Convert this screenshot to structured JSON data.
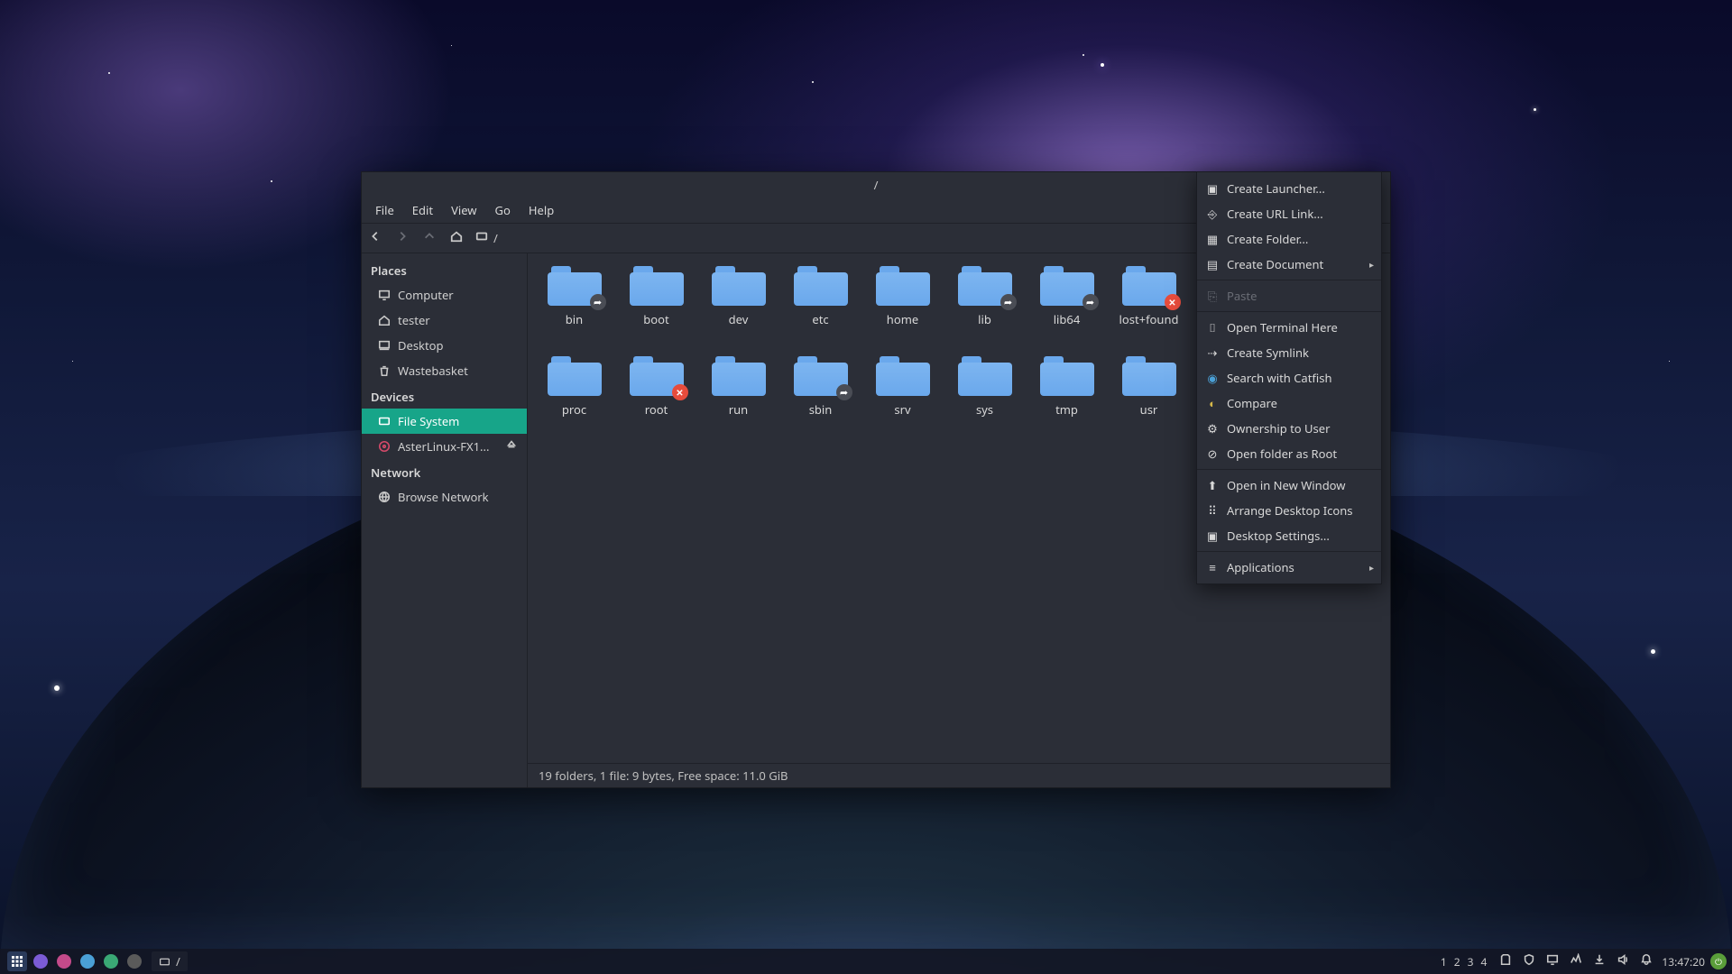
{
  "window": {
    "title": "/",
    "menu": {
      "file": "File",
      "edit": "Edit",
      "view": "View",
      "go": "Go",
      "help": "Help"
    },
    "path": "/"
  },
  "sidebar": {
    "places_hdr": "Places",
    "devices_hdr": "Devices",
    "network_hdr": "Network",
    "places": [
      {
        "label": "Computer",
        "icon": "monitor"
      },
      {
        "label": "tester",
        "icon": "home"
      },
      {
        "label": "Desktop",
        "icon": "desktop"
      },
      {
        "label": "Wastebasket",
        "icon": "trash"
      }
    ],
    "devices": [
      {
        "label": "File System",
        "icon": "disk",
        "selected": true
      },
      {
        "label": "AsterLinux-FX1...",
        "icon": "disc",
        "eject": true
      }
    ],
    "network": [
      {
        "label": "Browse Network",
        "icon": "globe"
      }
    ]
  },
  "folders": [
    {
      "name": "bin",
      "badge": "link"
    },
    {
      "name": "boot"
    },
    {
      "name": "dev"
    },
    {
      "name": "etc"
    },
    {
      "name": "home"
    },
    {
      "name": "lib",
      "badge": "link"
    },
    {
      "name": "lib64",
      "badge": "link"
    },
    {
      "name": "lost+found",
      "badge": "err"
    },
    {
      "name": "proc"
    },
    {
      "name": "root",
      "badge": "err"
    },
    {
      "name": "run"
    },
    {
      "name": "sbin",
      "badge": "link"
    },
    {
      "name": "srv"
    },
    {
      "name": "sys"
    },
    {
      "name": "tmp"
    },
    {
      "name": "usr"
    }
  ],
  "statusbar": "19 folders, 1 file: 9 bytes, Free space: 11.0 GiB",
  "context": [
    {
      "label": "Create Launcher...",
      "icon": "launcher"
    },
    {
      "label": "Create URL Link...",
      "icon": "url"
    },
    {
      "label": "Create Folder...",
      "icon": "newfolder"
    },
    {
      "label": "Create Document",
      "icon": "doc",
      "sub": true
    },
    {
      "sep": true
    },
    {
      "label": "Paste",
      "icon": "paste",
      "disabled": true
    },
    {
      "sep": true
    },
    {
      "label": "Open Terminal Here",
      "icon": "terminal"
    },
    {
      "label": "Create Symlink",
      "icon": "symlink"
    },
    {
      "label": "Search with Catfish",
      "icon": "catfish"
    },
    {
      "label": "Compare",
      "icon": "compare"
    },
    {
      "label": "Ownership to User",
      "icon": "gear"
    },
    {
      "label": "Open folder as Root",
      "icon": "root"
    },
    {
      "sep": true
    },
    {
      "label": "Open in New Window",
      "icon": "newwin"
    },
    {
      "label": "Arrange Desktop Icons",
      "icon": "arrange"
    },
    {
      "label": "Desktop Settings...",
      "icon": "settings"
    },
    {
      "sep": true
    },
    {
      "label": "Applications",
      "icon": "apps",
      "sub": true
    }
  ],
  "panel": {
    "task_label": "/",
    "workspaces": [
      "1",
      "2",
      "3",
      "4"
    ],
    "clock": "13:47:20"
  }
}
